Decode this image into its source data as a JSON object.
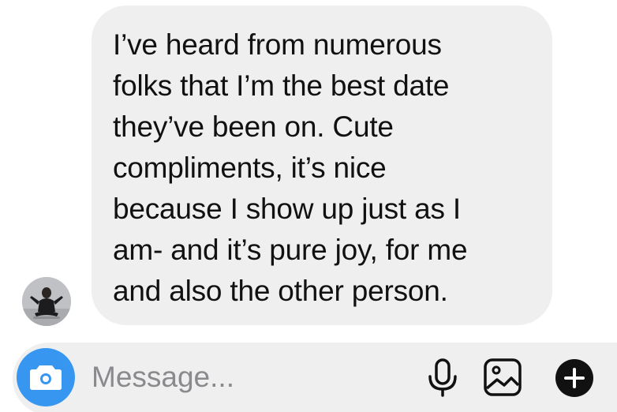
{
  "conversation": {
    "incoming_message": {
      "text": "I’ve heard from numerous\nfolks that I’m the best date\nthey’ve been on. Cute\ncompliments, it’s nice\nbecause I show up just as I\nam- and it’s pure joy, for me\nand also the other person."
    },
    "avatar": {
      "icon": "profile-photo"
    }
  },
  "composer": {
    "placeholder": "Message...",
    "value": "",
    "camera_icon": "camera-icon",
    "mic_icon": "microphone-icon",
    "gallery_icon": "image-icon",
    "plus_icon": "plus-icon",
    "accent_color": "#3797f0"
  },
  "colors": {
    "bubble_background": "#efefef",
    "text": "#111111",
    "placeholder": "#8a8a8e"
  }
}
